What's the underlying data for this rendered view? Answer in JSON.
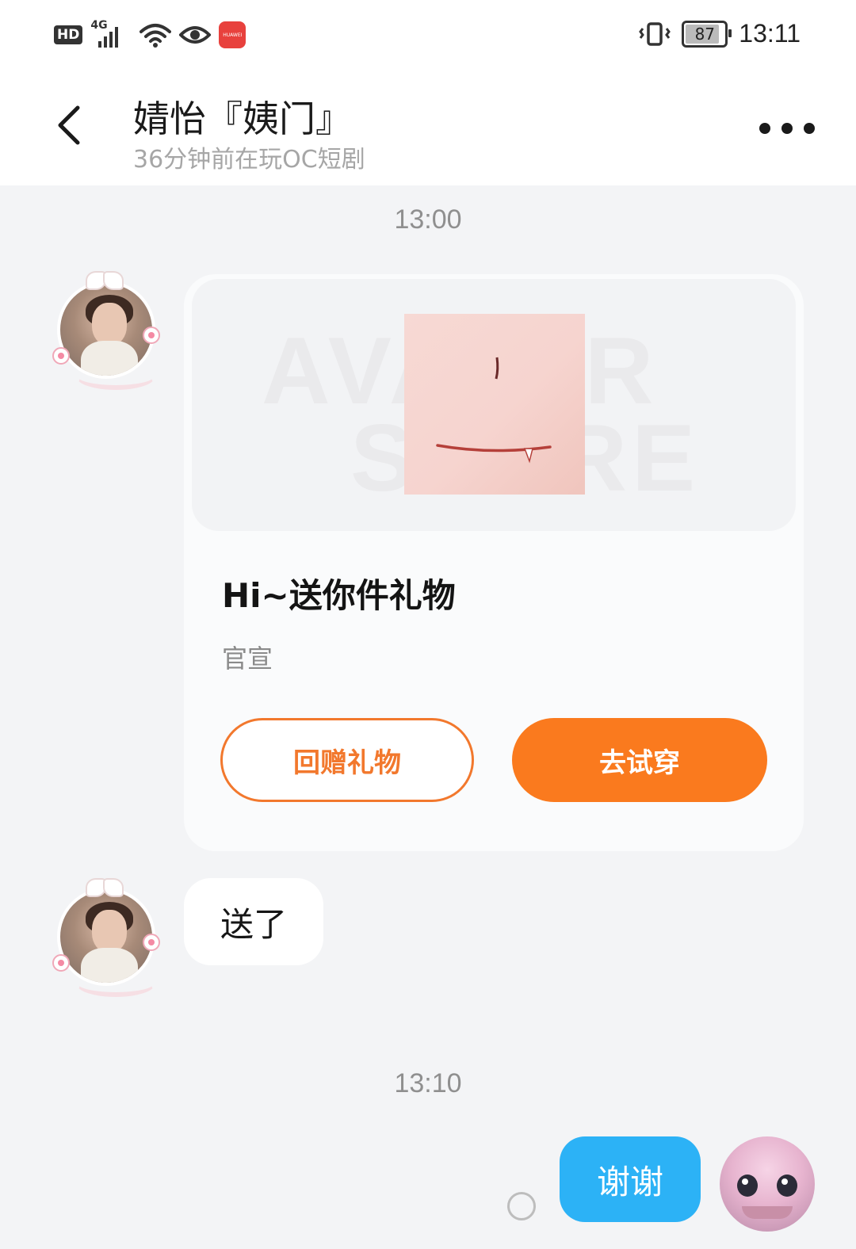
{
  "status_bar": {
    "hd": "HD",
    "network": "4G",
    "app_badge": "HUAWEI",
    "battery": "87",
    "time": "13:11"
  },
  "header": {
    "title": "婧怡『姨门』",
    "subtitle": "36分钟前在玩OC短剧"
  },
  "messages": {
    "timestamp_1": "13:00",
    "gift_card": {
      "watermark_line1": "AVATAR",
      "watermark_line2": "STORE",
      "title": "Hi~送你件礼物",
      "subtitle": "官宣",
      "return_gift_label": "回赠礼物",
      "try_on_label": "去试穿",
      "accent_color": "#fa7a1e"
    },
    "incoming_text": "送了",
    "timestamp_2": "13:10",
    "outgoing_text": "谢谢",
    "outgoing_color": "#2cb2f6"
  },
  "icons": {
    "back": "chevron-left-icon",
    "more": "more-dots-icon",
    "send_status": "sending-circle-icon"
  }
}
